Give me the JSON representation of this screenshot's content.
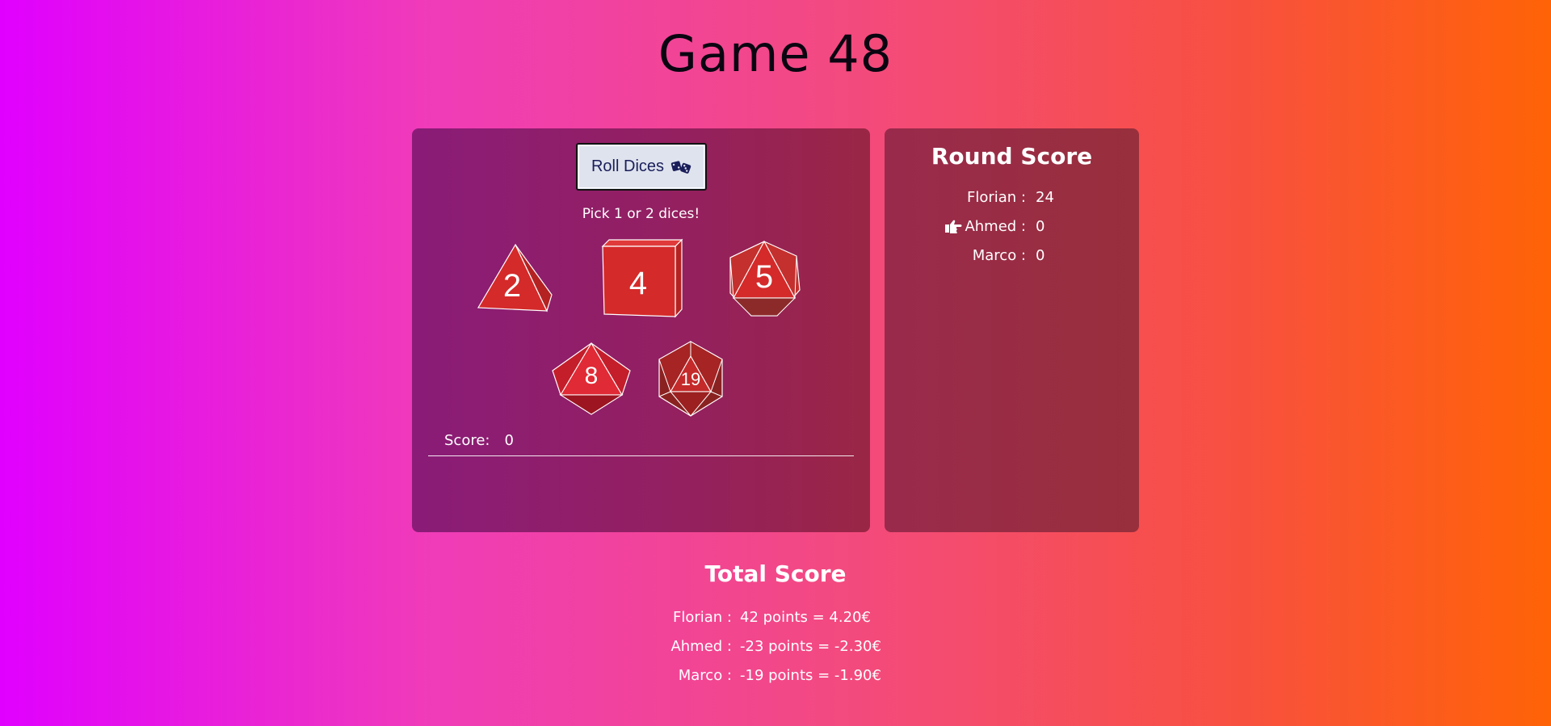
{
  "title": "Game 48",
  "game": {
    "roll_button_label": "Roll Dices",
    "hint": "Pick 1 or 2 dices!",
    "dice": [
      {
        "type": "d4",
        "value": "2"
      },
      {
        "type": "d6",
        "value": "4"
      },
      {
        "type": "d12",
        "value": "5"
      },
      {
        "type": "d8",
        "value": "8"
      },
      {
        "type": "d20",
        "value": "19"
      }
    ],
    "score_label": "Score:",
    "score_value": "0"
  },
  "round_score": {
    "title": "Round Score",
    "current_player_icon": "pointing-hand-icon",
    "players": [
      {
        "name": "Florian :",
        "score": "24",
        "current": false
      },
      {
        "name": "Ahmed :",
        "score": "0",
        "current": true
      },
      {
        "name": "Marco :",
        "score": "0",
        "current": false
      }
    ]
  },
  "total_score": {
    "title": "Total Score",
    "players": [
      {
        "name": "Florian :",
        "value": "42 points = 4.20€"
      },
      {
        "name": "Ahmed :",
        "value": "-23 points = -2.30€"
      },
      {
        "name": "Marco :",
        "value": "-19 points = -1.90€"
      }
    ]
  },
  "colors": {
    "die_red": "#d42a2a",
    "button_bg": "#dfe3ee",
    "button_text": "#1a1f5a"
  }
}
